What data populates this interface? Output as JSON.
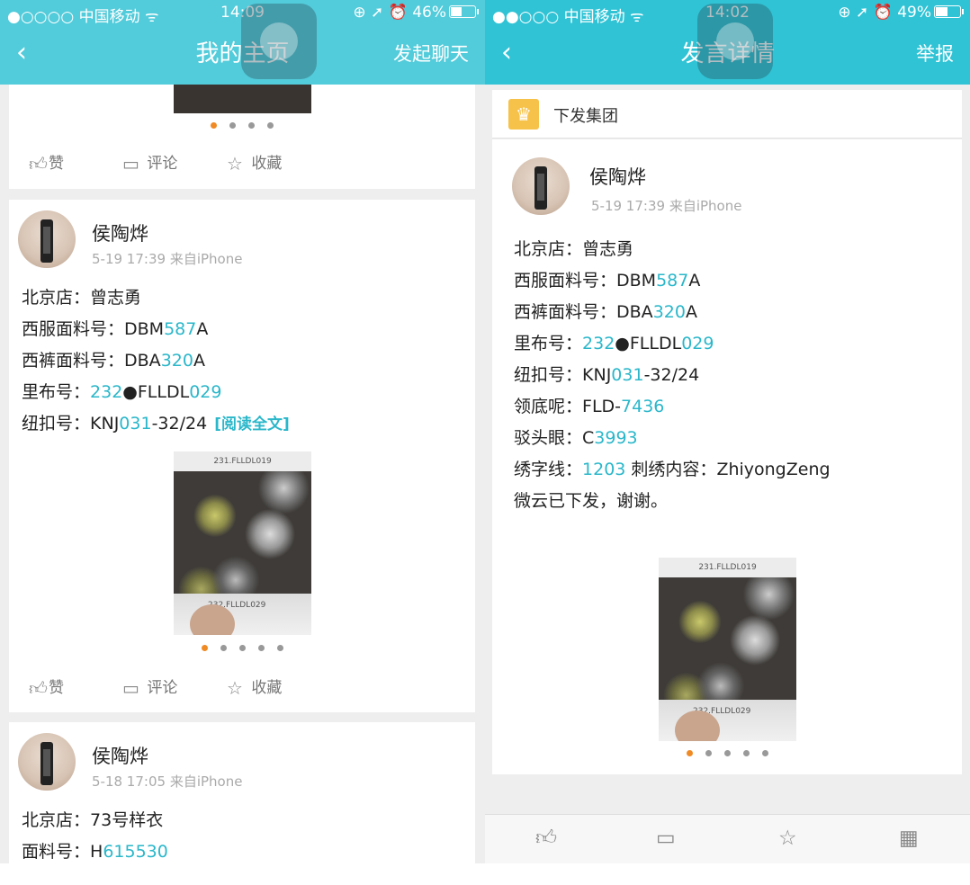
{
  "left": {
    "status": {
      "carrier": "●○○○○ 中国移动 ᯤ",
      "time": "14:09",
      "right": "⊕ ➚ ⏰ 46%",
      "battery": 0.46
    },
    "nav": {
      "back": "‹",
      "title": "我的主页",
      "action": "发起聊天"
    },
    "actions": {
      "like": "赞",
      "comment": "评论",
      "fav": "收藏"
    },
    "post1": {
      "name": "侯陶烨",
      "time": "5-19 17:39",
      "source": "来自iPhone",
      "l1_k": "北京店：",
      "l1_v": "曾志勇",
      "l2_k": "西服面料号：",
      "l2_a": "DBM",
      "l2_b": "587",
      "l2_c": "A",
      "l3_k": "西裤面料号：",
      "l3_a": "DBA",
      "l3_b": "320",
      "l3_c": "A",
      "l4_k": "里布号：",
      "l4_a": "232",
      "l4_b": "●FLLDL",
      "l4_c": "029",
      "l5_k": "纽扣号：",
      "l5_a": "KNJ",
      "l5_b": "031",
      "l5_c": "-32/24",
      "readmore": "[阅读全文]",
      "photo_top": "231.FLLDL019",
      "photo_bottom": "232.FLLDL029"
    },
    "post2": {
      "name": "侯陶烨",
      "time": "5-18 17:05",
      "source": "来自iPhone",
      "l1_k": "北京店：",
      "l1_v": "73号样衣",
      "l2_k": "面料号：",
      "l2_a": "H",
      "l2_b": "615530"
    }
  },
  "right": {
    "status": {
      "carrier": "●●○○○ 中国移动 ᯤ",
      "time": "14:02",
      "right": "⊕ ➚ ⏰ 49%",
      "battery": 0.49
    },
    "nav": {
      "back": "‹",
      "title": "发言详情",
      "action": "举报"
    },
    "group": {
      "icon": "crown-icon",
      "name": "下发集团"
    },
    "post": {
      "name": "侯陶烨",
      "time": "5-19 17:39",
      "source": "来自iPhone",
      "l1_k": "北京店：",
      "l1_v": "曾志勇",
      "l2_k": "西服面料号：",
      "l2_a": "DBM",
      "l2_b": "587",
      "l2_c": "A",
      "l3_k": "西裤面料号：",
      "l3_a": "DBA",
      "l3_b": "320",
      "l3_c": "A",
      "l4_k": "里布号：",
      "l4_a": "232",
      "l4_b": "●FLLDL",
      "l4_c": "029",
      "l5_k": "纽扣号：",
      "l5_a": "KNJ",
      "l5_b": "031",
      "l5_c": "-32/24",
      "l6_k": "领底呢：",
      "l6_a": "FLD-",
      "l6_b": "7436",
      "l7_k": "驳头眼：",
      "l7_a": "C",
      "l7_b": "3993",
      "l8_k": "绣字线：",
      "l8_b": "1203",
      "l8_k2": "刺绣内容：",
      "l8_c": "ZhiyongZeng",
      "l9": "微云已下发，谢谢。",
      "photo_top": "231.FLLDL019",
      "photo_bottom": "232.FLLDL029"
    }
  },
  "colors": {
    "nav": "#2fc3d5",
    "highlight": "#2ab7ca",
    "active_dot": "#f08a24",
    "crown": "#f7c24a"
  }
}
